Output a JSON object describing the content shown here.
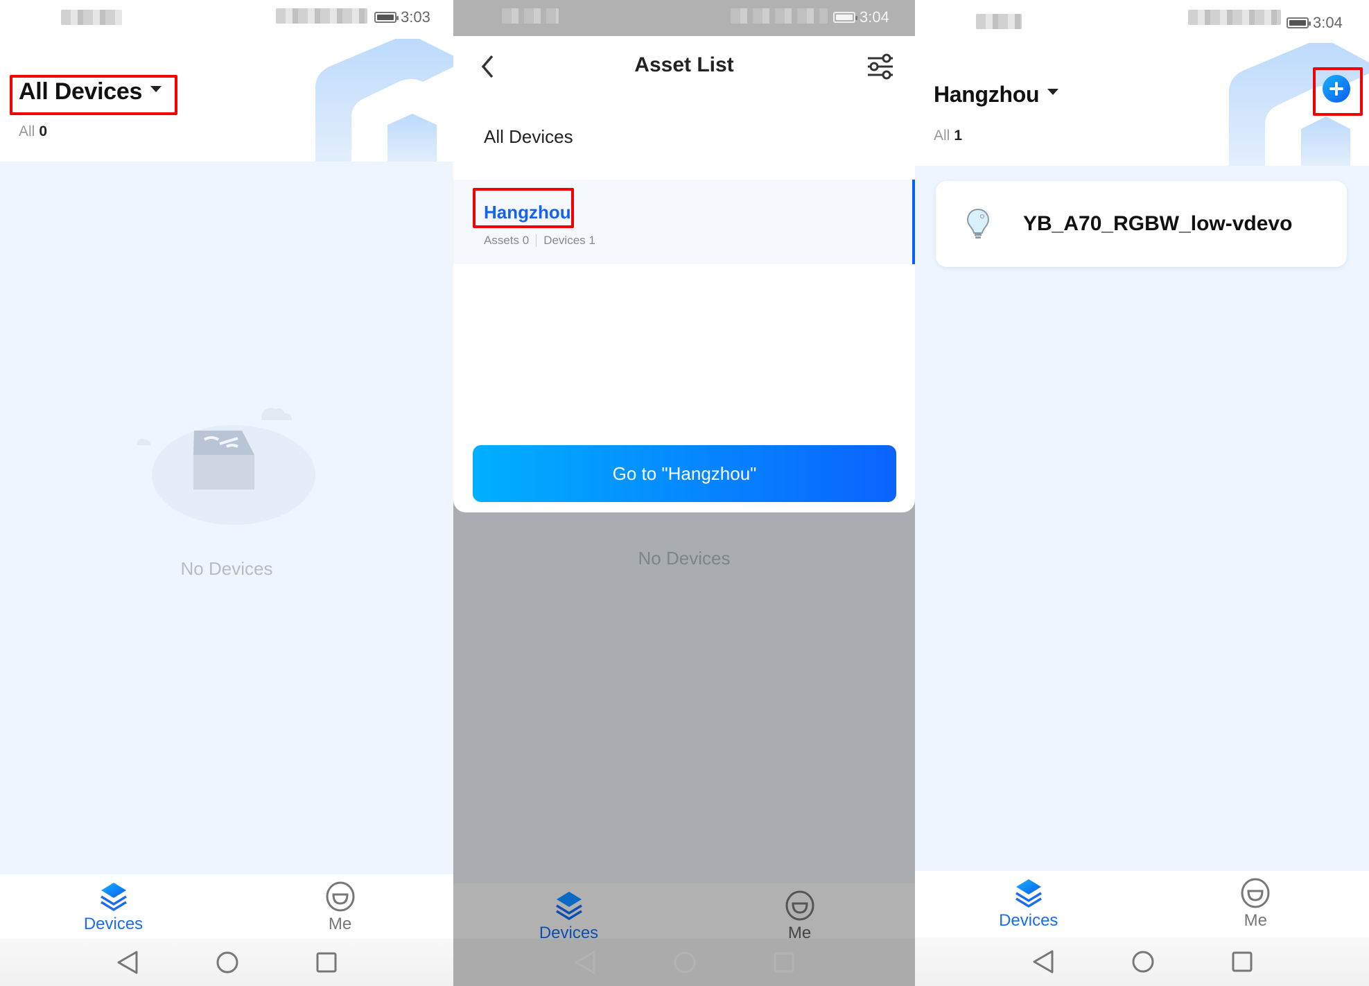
{
  "panels": [
    {
      "status_bar": {
        "time": "3:03"
      },
      "header": {
        "title": "All Devices",
        "count_label": "All",
        "count": "0"
      },
      "empty_state": {
        "text": "No Devices"
      },
      "tabs": [
        {
          "label": "Devices",
          "active": true,
          "icon": "layers-icon"
        },
        {
          "label": "Me",
          "active": false,
          "icon": "smiley-icon"
        }
      ]
    },
    {
      "status_bar": {
        "time": "3:04"
      },
      "asset_list": {
        "title": "Asset List",
        "all_item": "All Devices",
        "selected": {
          "name": "Hangzhou",
          "assets_label": "Assets 0",
          "devices_label": "Devices 1"
        },
        "button_label": "Go to \"Hangzhou\""
      },
      "empty_state": {
        "text": "No Devices"
      },
      "tabs": [
        {
          "label": "Devices",
          "active": true,
          "icon": "layers-icon"
        },
        {
          "label": "Me",
          "active": false,
          "icon": "smiley-icon"
        }
      ]
    },
    {
      "status_bar": {
        "time": "3:04"
      },
      "header": {
        "title": "Hangzhou",
        "count_label": "All",
        "count": "1"
      },
      "devices": [
        {
          "name": "YB_A70_RGBW_low-vdevo",
          "icon": "lightbulb-icon"
        }
      ],
      "tabs": [
        {
          "label": "Devices",
          "active": true,
          "icon": "layers-icon"
        },
        {
          "label": "Me",
          "active": false,
          "icon": "smiley-icon"
        }
      ]
    }
  ],
  "colors": {
    "accent": "#1a6cf0",
    "highlight_box": "#f30000",
    "page_bg": "#eef5fe"
  }
}
